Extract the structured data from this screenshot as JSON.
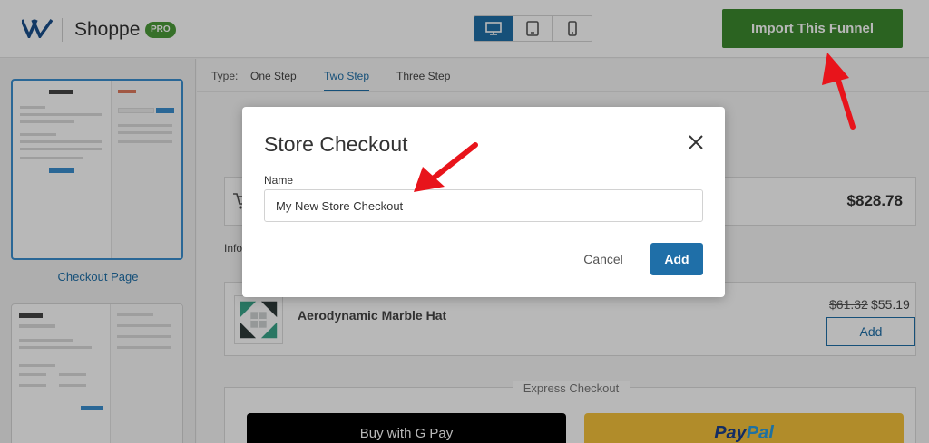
{
  "header": {
    "app_name": "Shoppe",
    "badge": "PRO",
    "devices": [
      "desktop-icon",
      "tablet-icon",
      "mobile-icon"
    ],
    "active_device": "desktop",
    "import_button": "Import This Funnel"
  },
  "sidebar": {
    "pages": [
      {
        "caption": "Checkout Page",
        "selected": true
      },
      {
        "caption": "",
        "selected": false
      }
    ]
  },
  "type_bar": {
    "label": "Type:",
    "tabs": [
      "One Step",
      "Two Step",
      "Three Step"
    ],
    "active": "Two Step"
  },
  "preview": {
    "summary_total": "$828.78",
    "info_label": "Info",
    "product": {
      "name": "Aerodynamic Marble Hat",
      "old_price": "$61.32",
      "new_price": "$55.19",
      "add_label": "Add"
    },
    "express": {
      "label": "Express Checkout",
      "gpay_text": "Buy with",
      "gpay_brand": "G Pay",
      "paypal_1": "Pay",
      "paypal_2": "Pal"
    }
  },
  "modal": {
    "title": "Store Checkout",
    "field_label": "Name",
    "field_value": "My New Store Checkout",
    "cancel_label": "Cancel",
    "add_label": "Add"
  },
  "colors": {
    "primary": "#1f6fa8",
    "import_green": "#3c8a2e",
    "annotation_red": "#e8141b"
  }
}
